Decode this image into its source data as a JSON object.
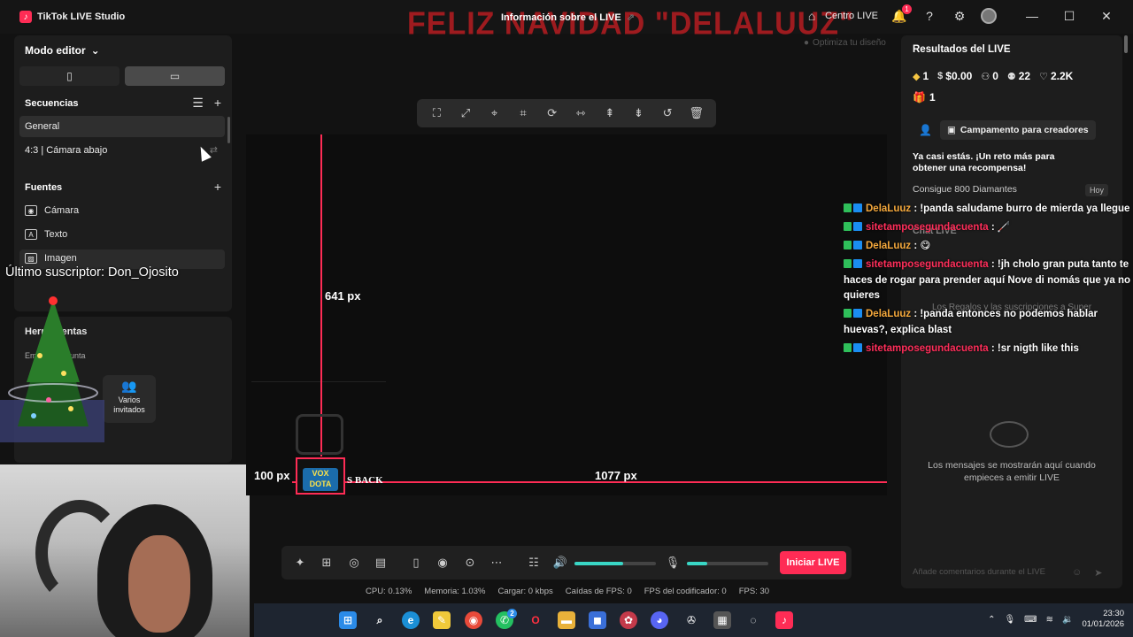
{
  "titlebar": {
    "app_title": "TikTok LIVE Studio",
    "overlay_text": "FELIZ NAVIDAD \"DELALUUZ\"",
    "live_info": "Información sobre el LIVE",
    "centro_live": "Centro LIVE",
    "notif_count": "1"
  },
  "editor": {
    "mode_label": "Modo editor",
    "sequences_title": "Secuencias",
    "sequences": [
      "General",
      "4:3 | Cámara abajo"
    ],
    "sources_title": "Fuentes",
    "sources": [
      "Cámara",
      "Texto",
      "Imagen"
    ],
    "subscriber_text": "Último suscriptor: Don_Ojosito",
    "tools_title": "Herramientas",
    "tools_sub": "Emisión conjunta",
    "tool_card": "Varios invitados"
  },
  "toolbar": {
    "optimize": "Optimiza tu diseño"
  },
  "canvas": {
    "measure_vertical": "641 px",
    "measure_left": "100 px",
    "measure_right": "1077 px",
    "logo_text": "VOX DOTA",
    "back_text": "S BACK"
  },
  "results": {
    "title": "Resultados del LIVE",
    "diamonds": "1",
    "money": "$0.00",
    "viewers": "0",
    "followers": "22",
    "likes": "2.2K",
    "gifts": "1",
    "camp_button": "Campamento para creadores",
    "challenge": "Ya casi estás. ¡Un reto más para obtener una recompensa!",
    "diamond_goal": "Consigue 800 Diamantes",
    "today": "Hoy",
    "chat_live": "Chat LIVE",
    "ghost_text": "Los Regalos y las suscripciones a Super",
    "empty_chat": "Los mensajes se mostrarán aquí cuando empieces a emitir LIVE",
    "comment_placeholder": "Añade comentarios durante el LIVE"
  },
  "chat": [
    {
      "user": "DelaLuuz",
      "style": "a",
      "text": " : !panda saludame burro de mierda ya llegue"
    },
    {
      "user": "sitetamposegundacuenta",
      "style": "b",
      "text": " : 🦯"
    },
    {
      "user": "DelaLuuz",
      "style": "a",
      "text": " : 😋"
    },
    {
      "user": "sitetamposegundacuenta",
      "style": "b",
      "text": " : !jh cholo gran puta tanto te haces de rogar para prender aquí Nove di nomás que ya no quieres"
    },
    {
      "user": "DelaLuuz",
      "style": "a",
      "text": " : !panda entonces no podemos hablar huevas?, explica blast"
    },
    {
      "user": "sitetamposegundacuenta",
      "style": "b",
      "text": " : !sr nigth like this"
    }
  ],
  "controls": {
    "go_live": "Iniciar LIVE",
    "volume_level": 0.6,
    "mic_level": 0.25
  },
  "status": {
    "cpu": "CPU: 0.13%",
    "memory": "Memoria: 1.03%",
    "upload": "Cargar: 0 kbps",
    "fps_drops": "Caídas de FPS: 0",
    "encoder_fps": "FPS del codificador: 0",
    "fps": "FPS: 30"
  },
  "taskbar": {
    "time": "23:30",
    "date": "01/01/2026",
    "whatsapp_badge": "2"
  },
  "colors": {
    "accent": "#fe2c55",
    "teal": "#39d6c5",
    "username_a": "#f4a83c",
    "username_b": "#ff2e5a"
  }
}
